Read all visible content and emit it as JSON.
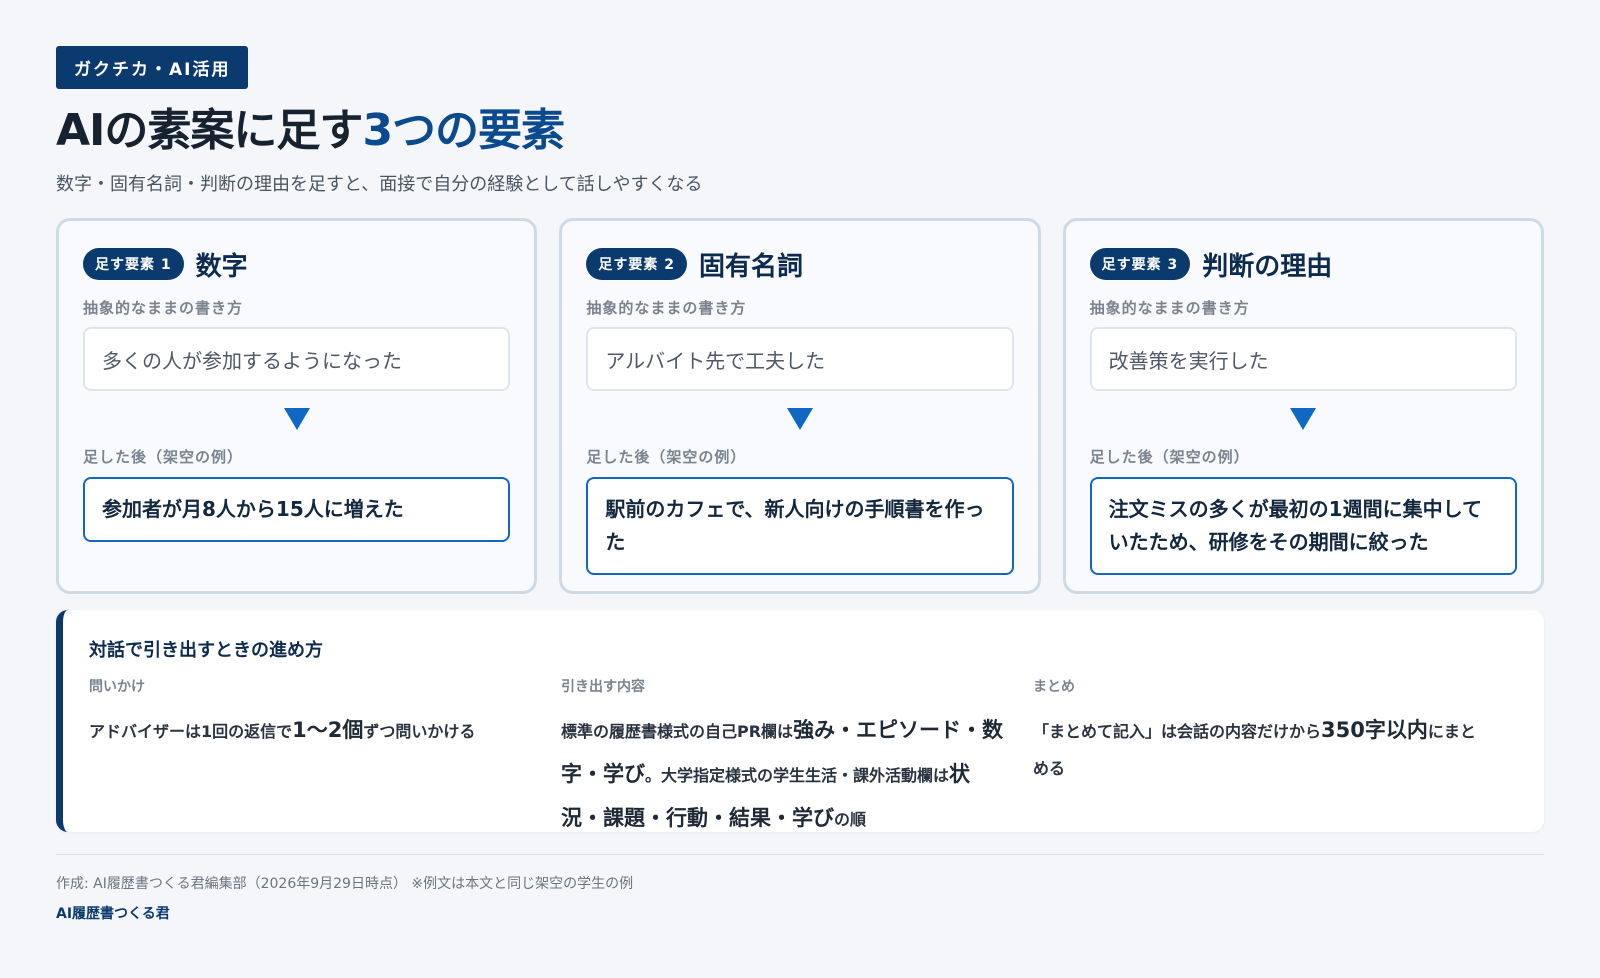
{
  "header": {
    "tag": "ガクチカ・AI活用",
    "title_main": "AIの素案に足す",
    "title_accent": "3つの要素",
    "subtitle": "数字・固有名詞・判断の理由を足すと、面接で自分の経験として話しやすくなる"
  },
  "cards": [
    {
      "pill": "足す要素 1",
      "title": "数字",
      "before_label": "抽象的なままの書き方",
      "before_text": "多くの人が参加するようになった",
      "after_label": "足した後（架空の例）",
      "after_text": "参加者が月8人から15人に増えた"
    },
    {
      "pill": "足す要素 2",
      "title": "固有名詞",
      "before_label": "抽象的なままの書き方",
      "before_text": "アルバイト先で工夫した",
      "after_label": "足した後（架空の例）",
      "after_text": "駅前のカフェで、新人向けの手順書を作った"
    },
    {
      "pill": "足す要素 3",
      "title": "判断の理由",
      "before_label": "抽象的なままの書き方",
      "before_text": "改善策を実行した",
      "after_label": "足した後（架空の例）",
      "after_text": "注文ミスの多くが最初の1週間に集中していたため、研修をその期間に絞った"
    }
  ],
  "dialog": {
    "title": "対話で引き出すときの進め方",
    "col1": {
      "label": "問いかけ",
      "t1": "アドバイザーは1回の返信で",
      "b1": "1〜2個",
      "t2": "ずつ問いかける"
    },
    "col2": {
      "label": "引き出す内容",
      "t1": "標準の履歴書様式の自己PR欄は",
      "b1": "強み・エピソード・数字・学び",
      "t2": "。大学指定様式の学生生活・課外活動欄は",
      "b2": "状況・課題・行動・結果・学び",
      "t3": "の順"
    },
    "col3": {
      "label": "まとめ",
      "t1": "「まとめて記入」は会話の内容だけから",
      "b1": "350字以内",
      "t2": "にまとめる"
    }
  },
  "footer": {
    "credit": "作成: AI履歴書つくる君編集部（2026年9月29日時点） ※例文は本文と同じ架空の学生の例",
    "brand": "AI履歴書つくる君"
  },
  "colors": {
    "navy": "#0b3a6f",
    "accent_blue": "#1167c4",
    "title_accent": "#0b4a8f"
  }
}
